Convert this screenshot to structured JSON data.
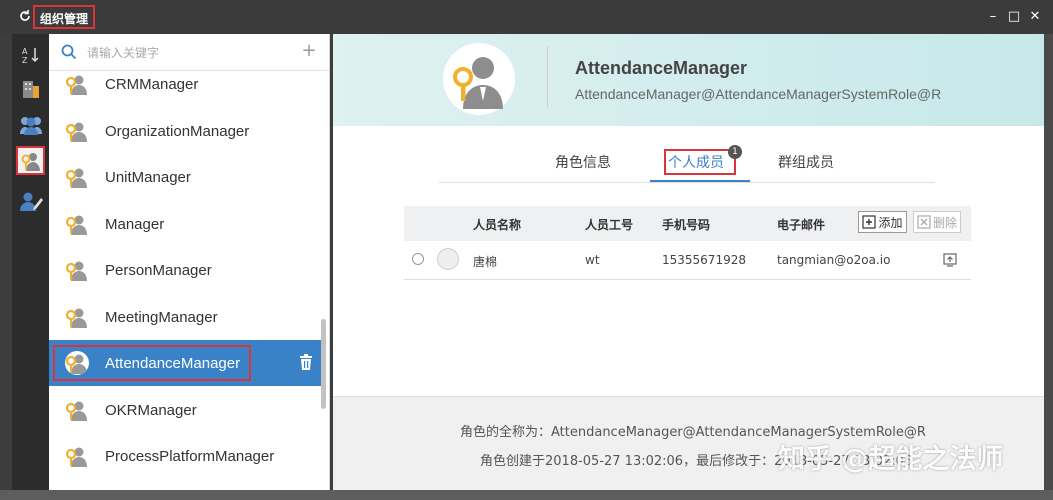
{
  "window": {
    "title": "组织管理",
    "minimize": "–",
    "maximize": "□",
    "close": "✕"
  },
  "rail": {
    "items": [
      {
        "name": "sort-icon",
        "active": false
      },
      {
        "name": "building-icon",
        "active": false
      },
      {
        "name": "group-icon",
        "active": false
      },
      {
        "name": "role-icon",
        "active": true
      },
      {
        "name": "person-edit-icon",
        "active": false
      }
    ]
  },
  "search": {
    "placeholder": "请输入关键字",
    "value": "",
    "add_label": "+"
  },
  "roles": {
    "items": [
      {
        "label": "CRMManager",
        "selected": false
      },
      {
        "label": "OrganizationManager",
        "selected": false
      },
      {
        "label": "UnitManager",
        "selected": false
      },
      {
        "label": "Manager",
        "selected": false
      },
      {
        "label": "PersonManager",
        "selected": false
      },
      {
        "label": "MeetingManager",
        "selected": false
      },
      {
        "label": "AttendanceManager",
        "selected": true
      },
      {
        "label": "OKRManager",
        "selected": false
      },
      {
        "label": "ProcessPlatformManager",
        "selected": false
      }
    ]
  },
  "detail": {
    "name": "AttendanceManager",
    "distinguished_name": "AttendanceManager@AttendanceManagerSystemRole@R",
    "tabs": [
      {
        "label": "角色信息",
        "active": false
      },
      {
        "label": "个人成员",
        "active": true,
        "badge": "1"
      },
      {
        "label": "群组成员",
        "active": false
      }
    ],
    "table": {
      "headers": [
        "人员名称",
        "人员工号",
        "手机号码",
        "电子邮件"
      ],
      "add_label": "添加",
      "delete_label": "删除",
      "rows": [
        {
          "name": "唐棉",
          "employee_id": "wt",
          "mobile": "15355671928",
          "email": "tangmian@o2oa.io"
        }
      ]
    },
    "footer": {
      "full_name_line": "角色的全称为：AttendanceManager@AttendanceManagerSystemRole@R",
      "created_line": "角色创建于2018-05-27 13:02:06，最后修改于：2018-05-27 13:02:06"
    }
  },
  "watermark": "知乎 @超能之法师"
}
